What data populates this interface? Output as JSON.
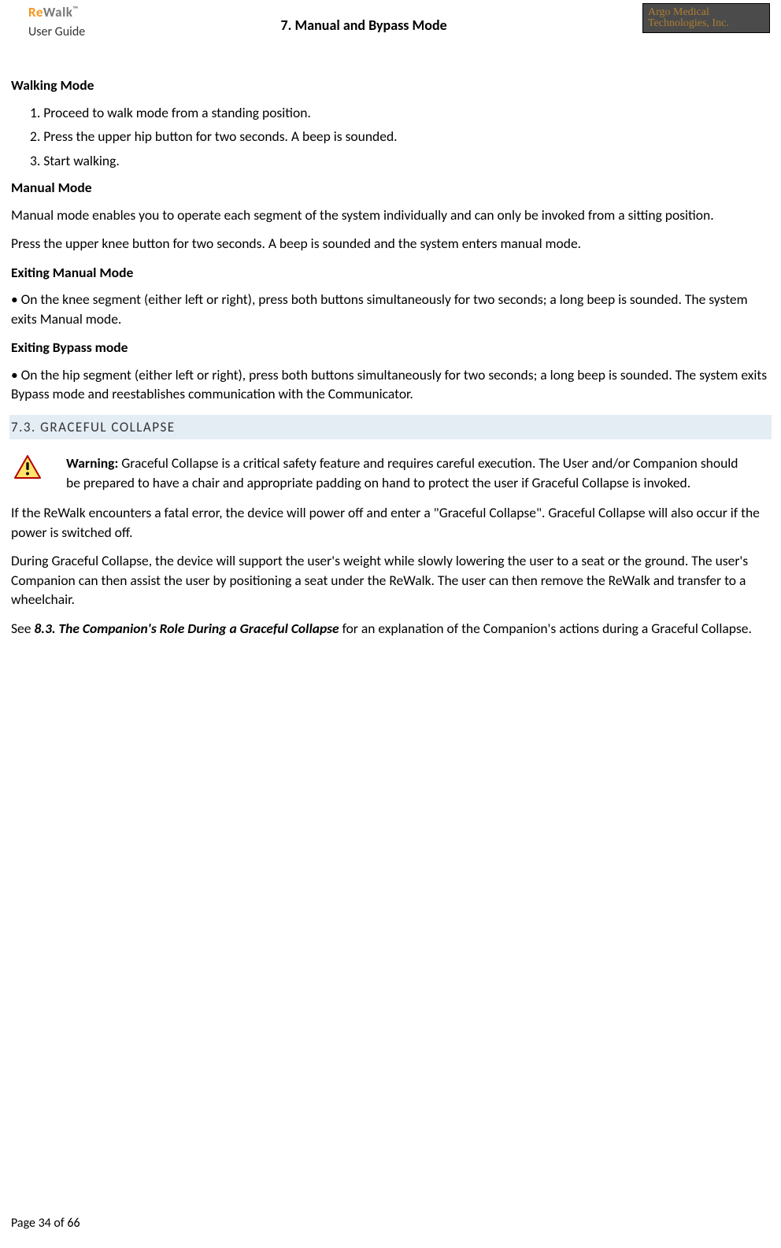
{
  "header": {
    "logo_re": "Re",
    "logo_walk": "Walk",
    "logo_tm": "™",
    "user_guide": "User Guide",
    "chapter": "7. Manual and Bypass Mode",
    "company_top": "Argo Medical",
    "company_bot": "Technologies, Inc."
  },
  "sections": {
    "walking_mode": {
      "title": "Walking Mode",
      "items": [
        "1. Proceed to walk mode from a standing position.",
        "2. Press the upper hip button for two seconds. A beep is sounded.",
        "3. Start walking."
      ]
    },
    "manual_mode": {
      "title": "Manual Mode",
      "p1": "Manual mode enables you to operate each segment of the system individually and can only be invoked from a sitting position.",
      "p2": "Press the upper knee button for two seconds. A beep is sounded and the system enters manual mode."
    },
    "exit_manual": {
      "title": "Exiting Manual Mode",
      "p1": "•   On the knee segment (either left or right), press both buttons simultaneously for two seconds; a long beep is sounded. The system exits Manual mode."
    },
    "exit_bypass": {
      "title": "Exiting Bypass mode",
      "p1": "• On the hip segment (either left or right), press both buttons simultaneously for two seconds; a long beep is sounded. The system exits Bypass mode and reestablishes communication with the Communicator."
    },
    "graceful": {
      "bar": "7.3. GRACEFUL COLLAPSE",
      "warn_label": "Warning: ",
      "warn_text": "Graceful Collapse is a critical safety feature and requires careful execution. The User and/or Companion should be prepared to have a chair and appropriate padding on hand to protect the user if Graceful Collapse is invoked.",
      "p1": "If the ReWalk encounters a fatal error, the device will power off and enter a \"Graceful Collapse\".  Graceful Collapse will also occur if the power is switched off.",
      "p2": "During Graceful Collapse, the device will support the user's weight while slowly lowering the user to a seat or the ground.  The user's Companion can then assist the user by positioning a seat under the ReWalk. The user can then remove the ReWalk and transfer to a wheelchair.",
      "see_pre": "See ",
      "ref": "8.3. The Companion's Role During a Graceful Collapse",
      "see_post": " for an explanation of the Companion's actions during a Graceful Collapse."
    }
  },
  "footer": {
    "page": "Page 34 of 66"
  }
}
